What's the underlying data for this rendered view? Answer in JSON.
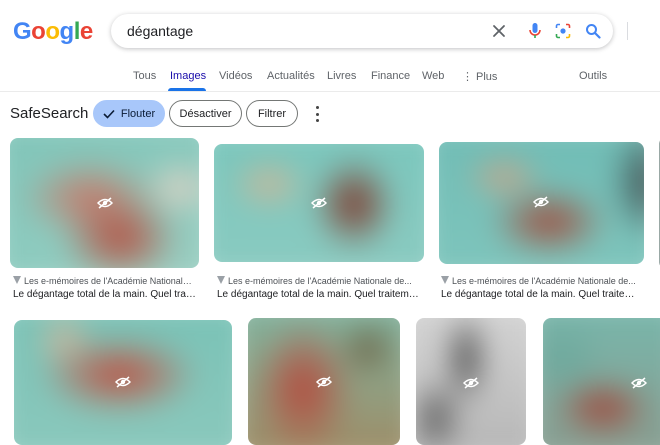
{
  "logo": {
    "text": "Google"
  },
  "search": {
    "query": "dégantage"
  },
  "tabs": [
    {
      "label": "Tous"
    },
    {
      "label": "Images"
    },
    {
      "label": "Vidéos"
    },
    {
      "label": "Actualités"
    },
    {
      "label": "Livres"
    },
    {
      "label": "Finance"
    },
    {
      "label": "Web"
    },
    {
      "label": "Plus"
    }
  ],
  "tools_label": "Outils",
  "safesearch": {
    "title": "SafeSearch",
    "chips": [
      {
        "label": "Flouter"
      },
      {
        "label": "Désactiver"
      },
      {
        "label": "Filtrer"
      }
    ]
  },
  "results": [
    {
      "source": "Les e-mémoires de l'Académie Nationale de...",
      "caption": "Le dégantage total de la main. Quel traitement..."
    },
    {
      "source": "Les e-mémoires de l'Académie Nationale de...",
      "caption": "Le dégantage total de la main. Quel traitement..."
    },
    {
      "source": "Les e-mémoires de l'Académie Nationale de...",
      "caption": "Le dégantage total de la main. Quel traitement..."
    }
  ],
  "colors": {
    "accent": "#1a73e8",
    "chip_selected": "#a8c7fa",
    "tab_active": "#1a0dab"
  }
}
